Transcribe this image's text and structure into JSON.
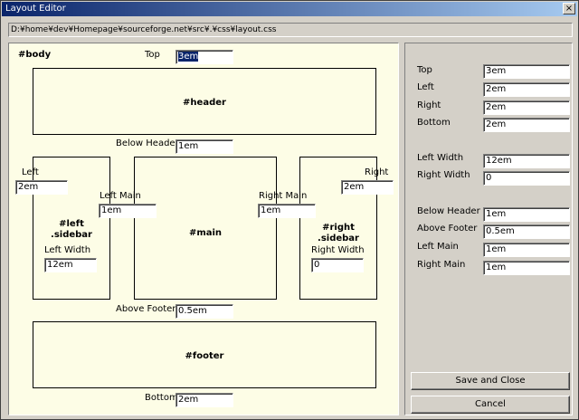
{
  "window": {
    "title": "Layout Editor",
    "close_glyph": "×"
  },
  "path": "D:¥home¥dev¥Homepage¥sourceforge.net¥src¥.¥css¥layout.css",
  "canvas": {
    "body_label": "#body",
    "top_label": "Top",
    "top_value": "3em",
    "header_label": "#header",
    "below_header_label": "Below Header",
    "below_header_value": "1em",
    "left_label": "Left",
    "left_value": "2em",
    "right_label": "Right",
    "right_value": "2em",
    "left_main_label": "Left Main",
    "left_main_value": "1em",
    "right_main_label": "Right Main",
    "right_main_value": "1em",
    "left_sidebar_label_1": "#left",
    "left_sidebar_label_2": ".sidebar",
    "right_sidebar_label_1": "#right",
    "right_sidebar_label_2": ".sidebar",
    "main_label": "#main",
    "left_width_label": "Left Width",
    "left_width_value": "12em",
    "right_width_label": "Right Width",
    "right_width_value": "0",
    "above_footer_label": "Above Footer",
    "above_footer_value": "0.5em",
    "footer_label": "#footer",
    "bottom_label": "Bottom",
    "bottom_value": "2em"
  },
  "panel": {
    "top_label": "Top",
    "top_value": "3em",
    "left_label": "Left",
    "left_value": "2em",
    "right_label": "Right",
    "right_value": "2em",
    "bottom_label": "Bottom",
    "bottom_value": "2em",
    "left_width_label": "Left Width",
    "left_width_value": "12em",
    "right_width_label": "Right Width",
    "right_width_value": "0",
    "below_header_label": "Below Header",
    "below_header_value": "1em",
    "above_footer_label": "Above Footer",
    "above_footer_value": "0.5em",
    "left_main_label": "Left Main",
    "left_main_value": "1em",
    "right_main_label": "Right Main",
    "right_main_value": "1em",
    "save_label": "Save and Close",
    "cancel_label": "Cancel"
  }
}
